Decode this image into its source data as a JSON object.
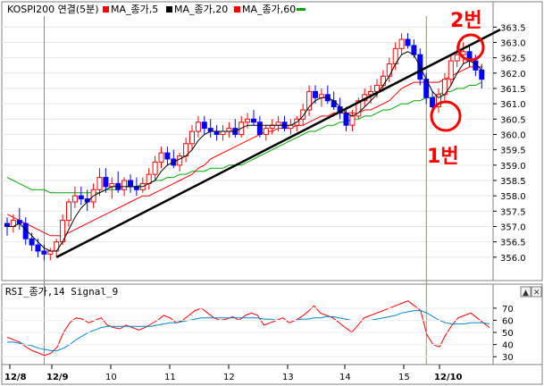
{
  "chart_data": [
    {
      "type": "candlestick",
      "legend": [
        {
          "label": "KOSPI200 연결(5분)",
          "color": "#000000"
        },
        {
          "label": "MA_종가,5",
          "color": "#ff0000"
        },
        {
          "label": "MA_종가,20",
          "color": "#000000"
        },
        {
          "label": "MA_종가,60",
          "color": "#00aa00"
        }
      ],
      "ylim": [
        355.5,
        363.8
      ],
      "yticks": [
        363.5,
        363.0,
        362.5,
        362.0,
        361.5,
        361.0,
        360.5,
        360.0,
        359.5,
        359.0,
        358.5,
        358.0,
        357.5,
        357.0,
        356.5,
        356.0
      ],
      "xlabels": [
        "12/8",
        "12/9",
        "10",
        "11",
        "12",
        "13",
        "14",
        "15",
        "12/10"
      ],
      "candles": [
        [
          357.1,
          357.3,
          356.7,
          357.0
        ],
        [
          357.0,
          357.4,
          356.8,
          357.2
        ],
        [
          357.2,
          357.6,
          356.9,
          357.1
        ],
        [
          357.1,
          357.3,
          356.4,
          356.6
        ],
        [
          356.6,
          356.8,
          356.2,
          356.4
        ],
        [
          356.4,
          356.6,
          356.0,
          356.2
        ],
        [
          356.2,
          356.4,
          355.9,
          356.1
        ],
        [
          356.1,
          356.3,
          355.9,
          356.2
        ],
        [
          356.2,
          356.6,
          356.0,
          356.5
        ],
        [
          356.5,
          357.4,
          356.4,
          357.2
        ],
        [
          357.2,
          357.9,
          357.0,
          357.8
        ],
        [
          357.8,
          358.3,
          357.6,
          358.0
        ],
        [
          358.0,
          358.3,
          357.7,
          357.9
        ],
        [
          357.9,
          358.2,
          357.5,
          357.8
        ],
        [
          357.8,
          358.4,
          357.6,
          358.2
        ],
        [
          358.2,
          358.9,
          358.0,
          358.6
        ],
        [
          358.6,
          358.9,
          358.1,
          358.3
        ],
        [
          358.3,
          358.6,
          357.9,
          358.4
        ],
        [
          358.4,
          358.8,
          358.1,
          358.2
        ],
        [
          358.2,
          358.6,
          358.0,
          358.5
        ],
        [
          358.5,
          358.7,
          358.1,
          358.3
        ],
        [
          358.3,
          358.6,
          358.0,
          358.2
        ],
        [
          358.2,
          358.6,
          358.1,
          358.4
        ],
        [
          358.4,
          358.9,
          358.2,
          358.7
        ],
        [
          358.7,
          359.3,
          358.5,
          359.1
        ],
        [
          359.1,
          359.6,
          358.9,
          359.4
        ],
        [
          359.4,
          359.6,
          359.0,
          359.2
        ],
        [
          359.2,
          359.5,
          358.9,
          359.0
        ],
        [
          359.0,
          359.4,
          358.8,
          359.3
        ],
        [
          359.3,
          359.9,
          359.1,
          359.7
        ],
        [
          359.7,
          360.3,
          359.5,
          360.1
        ],
        [
          360.1,
          360.6,
          359.9,
          360.4
        ],
        [
          360.4,
          360.6,
          360.0,
          360.2
        ],
        [
          360.2,
          360.5,
          359.9,
          360.1
        ],
        [
          360.1,
          360.3,
          359.8,
          360.0
        ],
        [
          360.0,
          360.3,
          359.8,
          360.1
        ],
        [
          360.1,
          360.4,
          359.9,
          360.2
        ],
        [
          360.2,
          360.5,
          359.9,
          360.0
        ],
        [
          360.0,
          360.6,
          359.9,
          360.4
        ],
        [
          360.4,
          360.7,
          360.2,
          360.5
        ],
        [
          360.5,
          360.8,
          360.3,
          360.4
        ],
        [
          360.4,
          360.6,
          359.9,
          360.0
        ],
        [
          360.0,
          360.3,
          359.8,
          360.2
        ],
        [
          360.2,
          360.5,
          360.0,
          360.3
        ],
        [
          360.3,
          360.6,
          360.1,
          360.4
        ],
        [
          360.4,
          360.6,
          360.1,
          360.2
        ],
        [
          360.2,
          360.5,
          360.0,
          360.3
        ],
        [
          360.3,
          360.6,
          360.1,
          360.5
        ],
        [
          360.5,
          361.0,
          360.3,
          360.8
        ],
        [
          360.8,
          361.6,
          360.6,
          361.4
        ],
        [
          361.4,
          361.6,
          361.0,
          361.2
        ],
        [
          361.2,
          361.5,
          360.9,
          361.3
        ],
        [
          361.3,
          361.6,
          361.0,
          361.1
        ],
        [
          361.1,
          361.4,
          360.8,
          360.9
        ],
        [
          360.9,
          361.2,
          360.5,
          360.7
        ],
        [
          360.7,
          360.9,
          360.1,
          360.3
        ],
        [
          360.3,
          360.8,
          360.1,
          360.6
        ],
        [
          360.6,
          361.2,
          360.5,
          361.1
        ],
        [
          361.1,
          361.5,
          360.9,
          361.3
        ],
        [
          361.3,
          361.6,
          361.0,
          361.4
        ],
        [
          361.4,
          361.8,
          361.2,
          361.6
        ],
        [
          361.6,
          362.1,
          361.4,
          361.9
        ],
        [
          361.9,
          362.5,
          361.7,
          362.3
        ],
        [
          362.3,
          363.0,
          362.1,
          362.8
        ],
        [
          362.8,
          363.3,
          362.6,
          363.1
        ],
        [
          363.1,
          363.3,
          362.8,
          362.9
        ],
        [
          362.9,
          363.1,
          362.5,
          362.6
        ],
        [
          362.6,
          362.8,
          361.6,
          361.8
        ],
        [
          361.8,
          362.0,
          361.0,
          361.2
        ],
        [
          361.2,
          361.4,
          360.7,
          360.9
        ],
        [
          360.9,
          361.5,
          360.7,
          361.3
        ],
        [
          361.3,
          362.0,
          361.1,
          361.8
        ],
        [
          361.8,
          362.6,
          361.6,
          362.4
        ],
        [
          362.4,
          362.9,
          362.2,
          362.6
        ],
        [
          362.6,
          363.0,
          362.3,
          362.7
        ],
        [
          362.7,
          362.9,
          362.2,
          362.4
        ],
        [
          362.4,
          362.6,
          361.9,
          362.1
        ],
        [
          362.1,
          362.3,
          361.5,
          361.8
        ]
      ],
      "ma5": [
        357.0,
        357.0,
        357.1,
        356.9,
        356.7,
        356.5,
        356.3,
        356.2,
        356.2,
        356.5,
        356.9,
        357.3,
        357.6,
        357.8,
        358.0,
        358.1,
        358.2,
        358.3,
        358.3,
        358.3,
        358.3,
        358.3,
        358.3,
        358.4,
        358.5,
        358.8,
        359.0,
        359.1,
        359.2,
        359.3,
        359.5,
        359.8,
        360.0,
        360.1,
        360.1,
        360.1,
        360.1,
        360.1,
        360.2,
        360.3,
        360.3,
        360.3,
        360.3,
        360.3,
        360.3,
        360.3,
        360.3,
        360.4,
        360.6,
        360.9,
        361.1,
        361.2,
        361.2,
        361.1,
        360.9,
        360.7,
        360.6,
        360.7,
        360.9,
        361.1,
        361.3,
        361.6,
        361.9,
        362.3,
        362.6,
        362.7,
        362.6,
        362.2,
        361.8,
        361.4,
        361.2,
        361.3,
        361.6,
        362.0,
        362.3,
        362.4,
        362.3,
        362.1
      ],
      "ma20": [
        357.4,
        357.3,
        357.2,
        357.1,
        357.0,
        356.9,
        356.8,
        356.7,
        356.7,
        356.7,
        356.8,
        356.9,
        357.0,
        357.1,
        357.2,
        357.3,
        357.4,
        357.5,
        357.6,
        357.7,
        357.8,
        357.9,
        358.0,
        358.0,
        358.1,
        358.2,
        358.3,
        358.4,
        358.5,
        358.6,
        358.7,
        358.9,
        359.0,
        359.2,
        359.3,
        359.4,
        359.5,
        359.6,
        359.7,
        359.8,
        359.9,
        360.0,
        360.1,
        360.1,
        360.2,
        360.2,
        360.2,
        360.3,
        360.3,
        360.4,
        360.5,
        360.6,
        360.6,
        360.7,
        360.7,
        360.7,
        360.7,
        360.7,
        360.8,
        360.8,
        360.9,
        361.0,
        361.1,
        361.3,
        361.5,
        361.6,
        361.7,
        361.7,
        361.7,
        361.7,
        361.7,
        361.8,
        361.9,
        362.0,
        362.1,
        362.2,
        362.2,
        362.2
      ],
      "ma60": [
        358.6,
        358.5,
        358.4,
        358.3,
        358.2,
        358.2,
        358.2,
        358.1,
        358.1,
        358.1,
        358.1,
        358.1,
        358.1,
        358.1,
        358.1,
        358.1,
        358.2,
        358.2,
        358.2,
        358.3,
        358.3,
        358.3,
        358.4,
        358.4,
        358.5,
        358.5,
        358.6,
        358.6,
        358.7,
        358.7,
        358.8,
        358.8,
        358.8,
        358.9,
        358.9,
        358.9,
        359.0,
        359.0,
        359.0,
        359.1,
        359.2,
        359.3,
        359.4,
        359.5,
        359.6,
        359.7,
        359.8,
        359.9,
        360.0,
        360.1,
        360.1,
        360.2,
        360.3,
        360.3,
        360.4,
        360.4,
        360.5,
        360.5,
        360.6,
        360.6,
        360.7,
        360.8,
        360.8,
        360.9,
        361.0,
        361.0,
        361.1,
        361.1,
        361.2,
        361.2,
        361.3,
        361.4,
        361.4,
        361.5,
        361.5,
        361.6,
        361.6,
        361.7
      ],
      "trendline": {
        "from": [
          8,
          356.0
        ],
        "to": [
          78,
          363.3
        ]
      },
      "annotations": [
        "2번",
        "1번"
      ],
      "colors": {
        "up": "#ff0000",
        "down": "#0000ff",
        "ma5": "#ff0000",
        "ma20": "#000000",
        "ma60": "#00aa00",
        "vline": "#999933",
        "circle": "#ff0000"
      }
    },
    {
      "type": "line",
      "title": "RSI_종가,14 Signal_9",
      "ylim": [
        25,
        78
      ],
      "yticks": [
        70,
        60,
        50,
        40,
        30
      ],
      "series": [
        {
          "name": "RSI_종가,14",
          "color": "#ff0000",
          "values": [
            46,
            44,
            42,
            38,
            35,
            33,
            31,
            33,
            38,
            50,
            58,
            62,
            61,
            58,
            60,
            62,
            56,
            54,
            53,
            56,
            54,
            52,
            54,
            57,
            60,
            64,
            62,
            58,
            60,
            64,
            68,
            70,
            66,
            62,
            60,
            61,
            63,
            60,
            64,
            66,
            64,
            56,
            58,
            60,
            62,
            58,
            60,
            63,
            67,
            72,
            66,
            64,
            62,
            58,
            54,
            50,
            56,
            62,
            64,
            66,
            68,
            70,
            72,
            74,
            76,
            72,
            68,
            48,
            40,
            38,
            48,
            56,
            62,
            64,
            66,
            62,
            58,
            54
          ]
        },
        {
          "name": "Signal_9",
          "color": "#0088cc",
          "values": [
            42,
            42,
            41,
            40,
            39,
            37,
            36,
            35,
            35,
            37,
            40,
            44,
            47,
            50,
            52,
            54,
            55,
            55,
            55,
            55,
            55,
            55,
            55,
            55,
            56,
            57,
            58,
            58,
            59,
            60,
            61,
            62,
            62,
            62,
            62,
            62,
            62,
            62,
            62,
            62,
            62,
            61,
            61,
            60,
            60,
            60,
            60,
            61,
            61,
            62,
            62,
            63,
            63,
            62,
            61,
            60,
            60,
            60,
            60,
            61,
            62,
            63,
            64,
            66,
            67,
            68,
            68,
            66,
            63,
            60,
            58,
            57,
            57,
            57,
            58,
            58,
            58,
            57
          ]
        }
      ]
    }
  ]
}
